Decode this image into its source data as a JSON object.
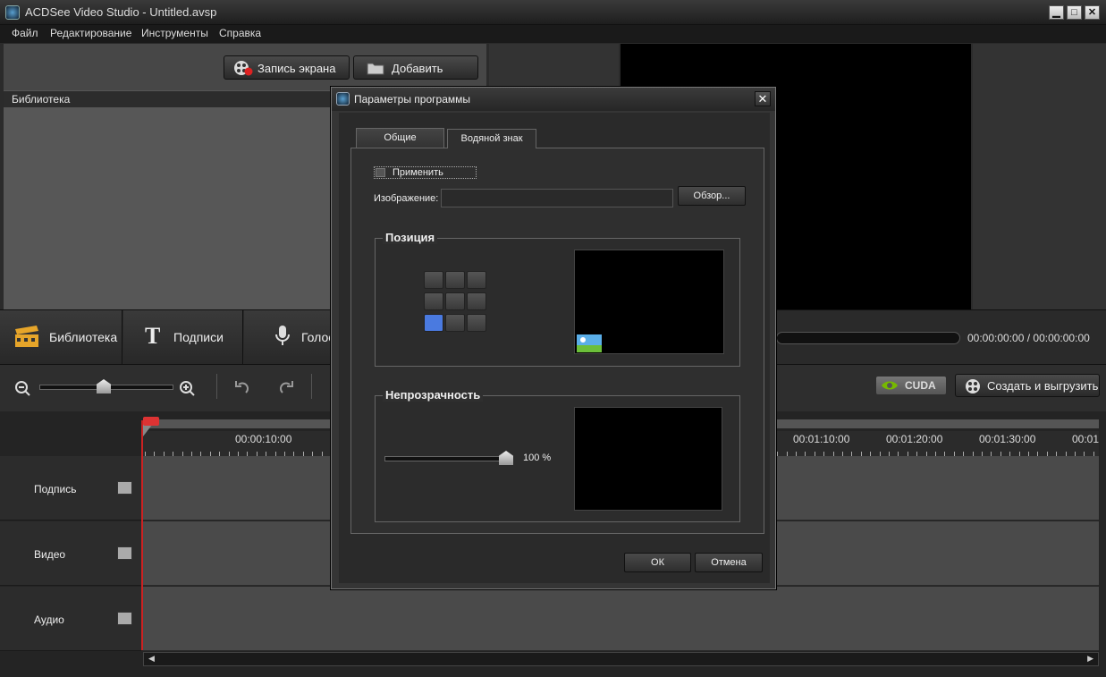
{
  "window": {
    "title": "ACDSee Video Studio - Untitled.avsp",
    "minimize": "▁",
    "maximize": "□",
    "close": "✕"
  },
  "menu": [
    "Файл",
    "Редактирование",
    "Инструменты",
    "Справка"
  ],
  "toolbar": {
    "record_label": "Запись экрана",
    "add_label": "Добавить"
  },
  "library": {
    "header": "Библиотека"
  },
  "bottom_tabs": [
    {
      "label": "Библиотека",
      "icon": "film-clapper-icon"
    },
    {
      "label": "Подписи",
      "icon": "text-t-icon"
    },
    {
      "label": "Голос",
      "icon": "microphone-icon"
    }
  ],
  "player": {
    "timecode": "00:00:00:00 / 00:00:00:00"
  },
  "tools": {
    "cuda_label": "CUDA",
    "export_label": "Создать и выгрузить",
    "zoom_level": 0.45
  },
  "ruler": {
    "labels": [
      "00:00:10:00",
      "00:01:10:00",
      "00:01:20:00",
      "00:01:30:00",
      "00:01"
    ]
  },
  "tracks": [
    {
      "label": "Подпись"
    },
    {
      "label": "Видео"
    },
    {
      "label": "Аудио"
    }
  ],
  "dialog": {
    "title": "Параметры программы",
    "close": "✕",
    "tabs": [
      {
        "label": "Общие"
      },
      {
        "label": "Водяной знак",
        "active": true
      }
    ],
    "apply_label": "Применить",
    "image_label": "Изображение:",
    "image_value": "",
    "browse_label": "Обзор...",
    "position_legend": "Позиция",
    "selected_position": "bottom-left",
    "opacity_legend": "Непрозрачность",
    "opacity_value": "100 %",
    "ok_label": "ОК",
    "cancel_label": "Отмена"
  }
}
